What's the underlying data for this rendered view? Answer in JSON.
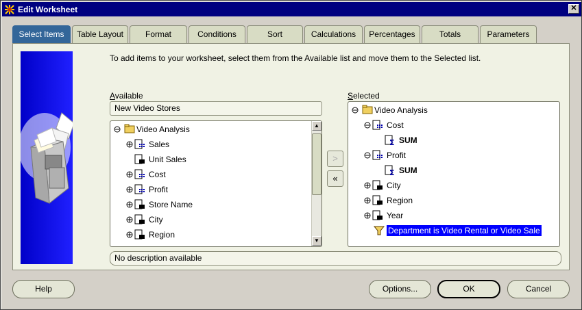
{
  "window": {
    "title": "Edit Worksheet",
    "close_glyph": "✕"
  },
  "tabs": [
    {
      "label": "Select Items",
      "active": true
    },
    {
      "label": "Table Layout"
    },
    {
      "label": "Format"
    },
    {
      "label": "Conditions"
    },
    {
      "label": "Sort"
    },
    {
      "label": "Calculations"
    },
    {
      "label": "Percentages"
    },
    {
      "label": "Totals"
    },
    {
      "label": "Parameters"
    }
  ],
  "instruction": "To add items to your worksheet, select them from the Available list and move them to the Selected list.",
  "available": {
    "label_underline": "A",
    "label_rest": "vailable",
    "business_area": "New Video Stores",
    "tree": [
      {
        "label": "Video Analysis",
        "icon": "folder-icon"
      },
      {
        "label": "Sales",
        "icon": "numeric-item-icon"
      },
      {
        "label": "Unit Sales",
        "icon": "item-icon"
      },
      {
        "label": "Cost",
        "icon": "numeric-item-icon"
      },
      {
        "label": "Profit",
        "icon": "numeric-item-icon"
      },
      {
        "label": "Store Name",
        "icon": "item-icon"
      },
      {
        "label": "City",
        "icon": "item-icon"
      },
      {
        "label": "Region",
        "icon": "item-icon"
      }
    ]
  },
  "selected": {
    "label_underline": "S",
    "label_rest": "elected",
    "tree": [
      {
        "label": "Video Analysis",
        "icon": "folder-icon"
      },
      {
        "label": "Cost",
        "icon": "numeric-item-icon"
      },
      {
        "label": "SUM",
        "icon": "sum-icon"
      },
      {
        "label": "Profit",
        "icon": "numeric-item-icon"
      },
      {
        "label": "SUM",
        "icon": "sum-icon"
      },
      {
        "label": "City",
        "icon": "item-icon"
      },
      {
        "label": "Region",
        "icon": "item-icon"
      },
      {
        "label": "Year",
        "icon": "item-icon"
      },
      {
        "label": "Department is Video Rental or Video Sale",
        "icon": "filter-icon"
      }
    ]
  },
  "move_buttons": {
    "add": ">",
    "remove": "«"
  },
  "description": "No description available",
  "buttons": {
    "help": "Help",
    "options": "Options...",
    "ok": "OK",
    "cancel": "Cancel"
  }
}
